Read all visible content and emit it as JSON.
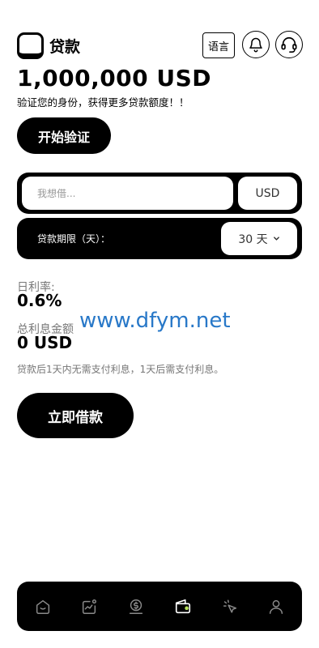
{
  "header": {
    "title": "贷款",
    "language_button": "语言",
    "logo_icon": "app-logo-icon",
    "notification_icon": "bell-icon",
    "support_icon": "headset-icon"
  },
  "loan": {
    "max_amount": "1,000,000 USD",
    "subtitle": "验证您的身份，获得更多贷款额度！！",
    "verify_button": "开始验证"
  },
  "form": {
    "amount_placeholder": "我想借...",
    "currency": "USD",
    "term_label": "贷款期限（天）：",
    "term_value": "30 天",
    "term_dropdown_icon": "chevron-down-icon"
  },
  "summary": {
    "daily_rate_label": "日利率:",
    "daily_rate_value": "0.6%",
    "total_interest_label": "总利息金额",
    "total_interest_value": "0 USD",
    "note": "贷款后1天内无需支付利息，1天后需支付利息。"
  },
  "watermark": "www.dfym.net",
  "borrow_button": "立即借款",
  "bottom_nav": {
    "items": [
      {
        "icon": "home-icon",
        "active": false
      },
      {
        "icon": "chart-icon",
        "active": false
      },
      {
        "icon": "dollar-coin-icon",
        "active": false
      },
      {
        "icon": "wallet-icon",
        "active": true
      },
      {
        "icon": "cursor-click-icon",
        "active": false
      },
      {
        "icon": "user-icon",
        "active": false
      }
    ],
    "active_color": "#ffffff",
    "inactive_color": "#8a8a8a",
    "accent_color": "#b6e35a"
  }
}
